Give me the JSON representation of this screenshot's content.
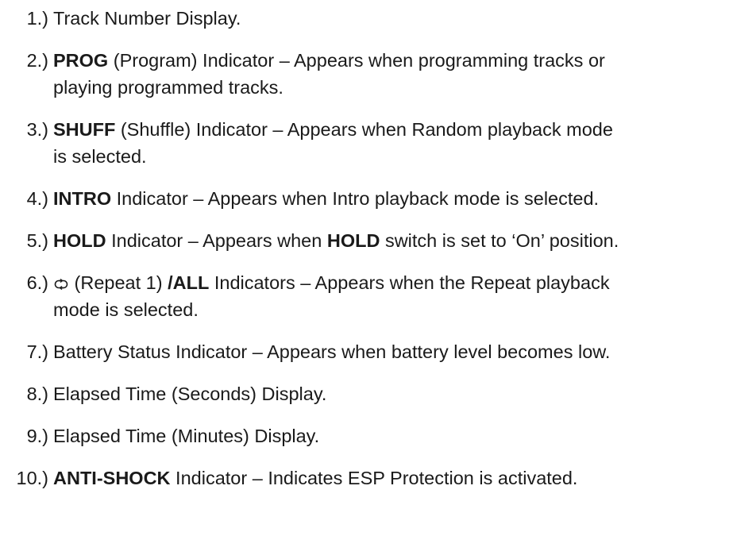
{
  "items": [
    {
      "num": "1.)",
      "lines": [
        {
          "t": "Track Number Display."
        }
      ]
    },
    {
      "num": "2.)",
      "lines": [
        {
          "b1": "PROG",
          "t": " (Program) Indicator – Appears when programming tracks or"
        },
        {
          "t": "playing programmed tracks."
        }
      ]
    },
    {
      "num": "3.)",
      "lines": [
        {
          "b1": "SHUFF",
          "t": " (Shuffle) Indicator – Appears when Random playback mode"
        },
        {
          "t": "is selected."
        }
      ]
    },
    {
      "num": "4.)",
      "lines": [
        {
          "b1": "INTRO",
          "t": " Indicator – Appears when Intro playback mode is selected."
        }
      ]
    },
    {
      "num": "5.)",
      "lines": [
        {
          "b1": "HOLD",
          "t": " Indicator – Appears when ",
          "b2": "HOLD",
          "t2": " switch is set to ‘On’ position."
        }
      ]
    },
    {
      "num": "6.)",
      "icon": "repeat-icon",
      "lines": [
        {
          "t": " (Repeat 1) ",
          "b2": "/ALL",
          "t2": " Indicators – Appears when the Repeat playback"
        },
        {
          "t": "mode is selected."
        }
      ]
    },
    {
      "num": "7.)",
      "lines": [
        {
          "t": "Battery Status Indicator – Appears when battery level becomes low."
        }
      ]
    },
    {
      "num": "8.)",
      "lines": [
        {
          "t": "Elapsed Time (Seconds) Display."
        }
      ]
    },
    {
      "num": "9.)",
      "lines": [
        {
          "t": "Elapsed Time (Minutes) Display."
        }
      ]
    },
    {
      "num": "10.)",
      "lines": [
        {
          "b1": "ANTI-SHOCK",
          "t": " Indicator – Indicates ESP Protection is activated."
        }
      ]
    }
  ]
}
